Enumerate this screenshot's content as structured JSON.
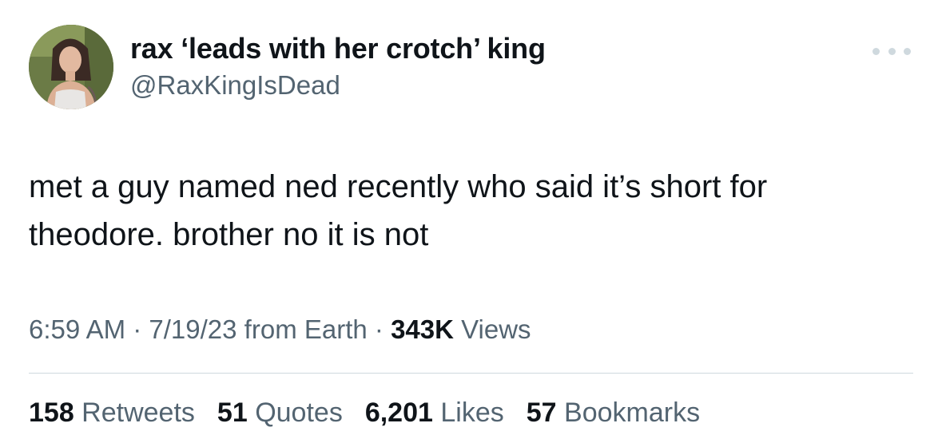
{
  "author": {
    "display_name": "rax ‘leads with her crotch’ king",
    "handle": "@RaxKingIsDead"
  },
  "tweet": {
    "lines": [
      "met a guy named ned recently who said it’s short for",
      "theodore. brother no it is not"
    ]
  },
  "meta": {
    "time": "6:59 AM",
    "sep1": " · ",
    "date": "7/19/23",
    "source": " from Earth",
    "sep2": " · ",
    "views_count": "343K",
    "views_label": " Views"
  },
  "stats": [
    {
      "count": "158",
      "label": " Retweets"
    },
    {
      "count": "51",
      "label": " Quotes"
    },
    {
      "count": "6,201",
      "label": " Likes"
    },
    {
      "count": "57",
      "label": " Bookmarks"
    }
  ],
  "icons": {
    "more": "more-options-icon",
    "avatar": "profile-photo"
  },
  "colors": {
    "primary_text": "#0f1419",
    "secondary_text": "#536471",
    "divider": "#cfd9de"
  }
}
